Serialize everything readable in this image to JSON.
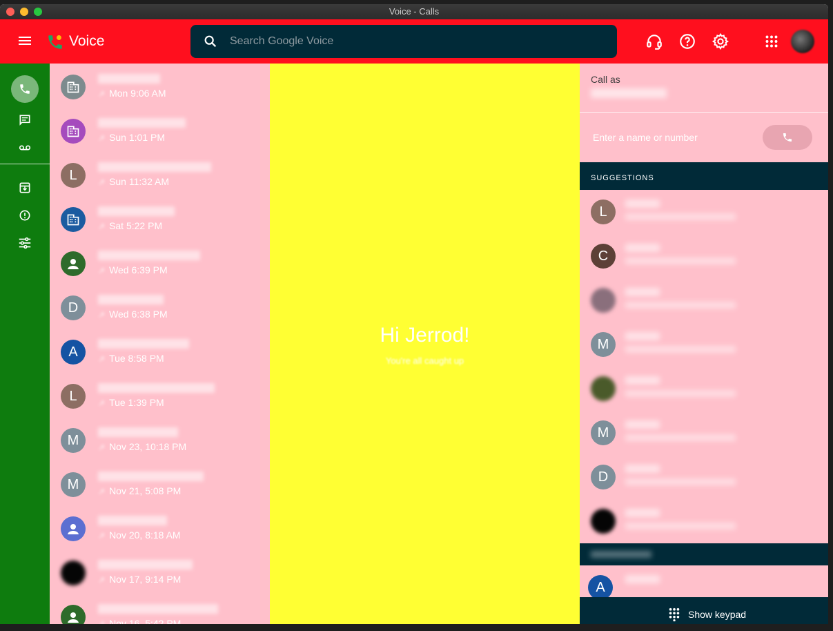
{
  "window": {
    "title": "Voice - Calls"
  },
  "header": {
    "app_name": "Voice",
    "search_placeholder": "Search Google Voice",
    "icons": [
      "menu-icon",
      "voice-logo-icon",
      "search-icon",
      "headset-icon",
      "help-icon",
      "settings-icon",
      "apps-icon",
      "account-avatar"
    ]
  },
  "nav": {
    "items": [
      "calls",
      "messages",
      "voicemail",
      "archive",
      "spam",
      "settings"
    ]
  },
  "calls": [
    {
      "avatar_type": "business",
      "avatar_color": "#7d8b8e",
      "letter": "",
      "time": "Mon 9:06 AM"
    },
    {
      "avatar_type": "business",
      "avatar_color": "#a54bbd",
      "letter": "",
      "time": "Sun 1:01 PM"
    },
    {
      "avatar_type": "letter",
      "avatar_color": "#8d6e63",
      "letter": "L",
      "time": "Sun 11:32 AM"
    },
    {
      "avatar_type": "business",
      "avatar_color": "#1b5ba0",
      "letter": "",
      "time": "Sat 5:22 PM"
    },
    {
      "avatar_type": "person",
      "avatar_color": "#2e6b2b",
      "letter": "",
      "time": "Wed 6:39 PM"
    },
    {
      "avatar_type": "letter",
      "avatar_color": "#7e8f9a",
      "letter": "D",
      "time": "Wed 6:38 PM"
    },
    {
      "avatar_type": "letter",
      "avatar_color": "#1553a3",
      "letter": "A",
      "time": "Tue 8:58 PM"
    },
    {
      "avatar_type": "letter",
      "avatar_color": "#8d6e63",
      "letter": "L",
      "time": "Tue 1:39 PM"
    },
    {
      "avatar_type": "letter",
      "avatar_color": "#7e8f9a",
      "letter": "M",
      "time": "Nov 23, 10:18 PM"
    },
    {
      "avatar_type": "letter",
      "avatar_color": "#7e8f9a",
      "letter": "M",
      "time": "Nov 21, 5:08 PM"
    },
    {
      "avatar_type": "person",
      "avatar_color": "#5b6fd1",
      "letter": "",
      "time": "Nov 20, 8:18 AM"
    },
    {
      "avatar_type": "photo",
      "avatar_color": "#050505",
      "letter": "",
      "time": "Nov 17, 9:14 PM"
    },
    {
      "avatar_type": "person",
      "avatar_color": "#2e6b2b",
      "letter": "",
      "time": "Nov 16, 5:42 PM"
    }
  ],
  "center": {
    "greeting": "Hi Jerrod!",
    "subtitle": "You're all caught up"
  },
  "dialer": {
    "call_as_label": "Call as",
    "input_placeholder": "Enter a name or number",
    "suggestions_header": "SUGGESTIONS",
    "suggestions": [
      {
        "avatar_type": "letter",
        "avatar_color": "#8d6e63",
        "letter": "L"
      },
      {
        "avatar_type": "letter",
        "avatar_color": "#5d4037",
        "letter": "C"
      },
      {
        "avatar_type": "photo",
        "avatar_color": "#8a6f7c",
        "letter": ""
      },
      {
        "avatar_type": "letter",
        "avatar_color": "#7e8f9a",
        "letter": "M"
      },
      {
        "avatar_type": "photo",
        "avatar_color": "#4a5a2a",
        "letter": ""
      },
      {
        "avatar_type": "letter",
        "avatar_color": "#7e8f9a",
        "letter": "M"
      },
      {
        "avatar_type": "letter",
        "avatar_color": "#7e8f9a",
        "letter": "D"
      },
      {
        "avatar_type": "photo",
        "avatar_color": "#050505",
        "letter": ""
      }
    ],
    "contacts": [
      {
        "avatar_type": "letter",
        "avatar_color": "#1553a3",
        "letter": "A"
      }
    ],
    "keypad_label": "Show keypad"
  },
  "colors": {
    "topbar": "#ff0f1e",
    "nav": "#0e7c0e",
    "list": "#ffc0cb",
    "center": "#ffff33",
    "dark": "#012a38"
  }
}
